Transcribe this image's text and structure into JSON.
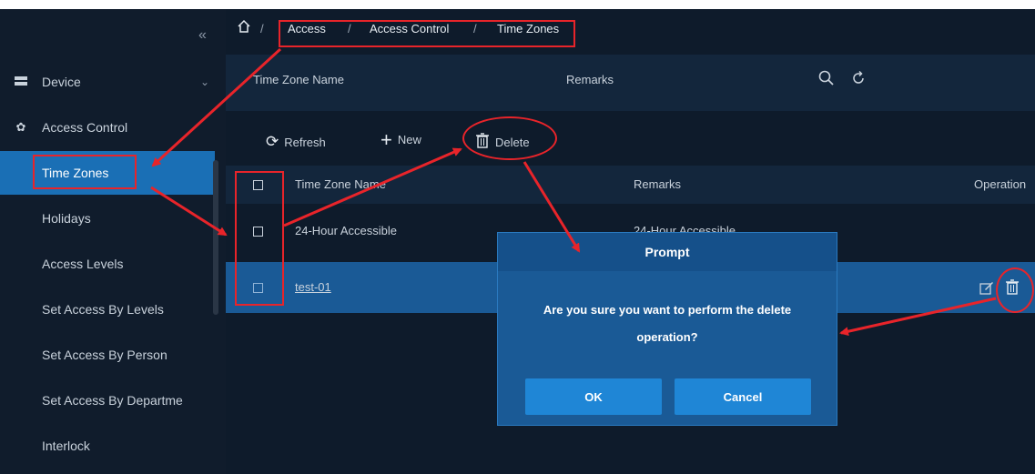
{
  "sidebar": {
    "collapse_icon": "double-chevron-left-icon",
    "items": [
      {
        "label": "Device",
        "icon": "device-icon"
      },
      {
        "label": "Access Control",
        "icon": "gear-icon"
      }
    ],
    "subitems": [
      {
        "label": "Time Zones",
        "active": true
      },
      {
        "label": "Holidays"
      },
      {
        "label": "Access Levels"
      },
      {
        "label": "Set Access By Levels"
      },
      {
        "label": "Set Access By Person"
      },
      {
        "label": "Set Access By Departme"
      },
      {
        "label": "Interlock"
      }
    ]
  },
  "breadcrumb": {
    "home_icon": "home-icon",
    "separator": "/",
    "items": [
      "Access",
      "Access Control",
      "Time Zones"
    ]
  },
  "search": {
    "field1_label": "Time Zone Name",
    "field2_label": "Remarks",
    "search_icon": "search-icon",
    "reset_icon": "reset-icon"
  },
  "toolbar": {
    "refresh_label": "Refresh",
    "new_label": "New",
    "delete_label": "Delete"
  },
  "table": {
    "columns": [
      "Time Zone Name",
      "Remarks",
      "Operation"
    ],
    "rows": [
      {
        "name": "24-Hour Accessible",
        "remarks": "24-Hour Accessible",
        "selected": false
      },
      {
        "name": "test-01",
        "remarks": "",
        "selected": true
      }
    ]
  },
  "modal": {
    "title": "Prompt",
    "message": "Are you sure you want to perform the delete operation?",
    "ok_label": "OK",
    "cancel_label": "Cancel"
  },
  "colors": {
    "background": "#0e1b2b",
    "sidebar_active": "#1a6fb5",
    "modal": "#1a5a96",
    "button": "#1f86d6",
    "annotation": "#e8242a"
  }
}
